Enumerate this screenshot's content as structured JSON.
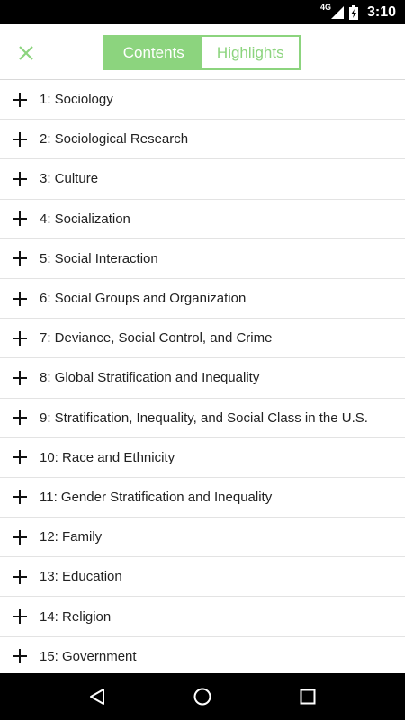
{
  "status_bar": {
    "network": "4G",
    "time": "3:10"
  },
  "header": {
    "tabs": [
      {
        "label": "Contents",
        "active": true
      },
      {
        "label": "Highlights",
        "active": false
      }
    ],
    "accent_color": "#8cd47e"
  },
  "contents": {
    "items": [
      {
        "label": "1: Sociology"
      },
      {
        "label": "2: Sociological Research"
      },
      {
        "label": "3: Culture"
      },
      {
        "label": "4: Socialization"
      },
      {
        "label": "5: Social Interaction"
      },
      {
        "label": "6: Social Groups and Organization"
      },
      {
        "label": "7: Deviance, Social Control, and Crime"
      },
      {
        "label": "8: Global Stratification and Inequality"
      },
      {
        "label": "9: Stratification, Inequality, and Social Class in the U.S."
      },
      {
        "label": "10: Race and Ethnicity"
      },
      {
        "label": "11: Gender Stratification and Inequality"
      },
      {
        "label": "12: Family"
      },
      {
        "label": "13: Education"
      },
      {
        "label": "14: Religion"
      },
      {
        "label": "15: Government"
      }
    ]
  },
  "icons": {
    "close": "close-icon",
    "expand": "plus-icon",
    "back": "back-triangle-icon",
    "home": "home-circle-icon",
    "recents": "recents-square-icon"
  }
}
